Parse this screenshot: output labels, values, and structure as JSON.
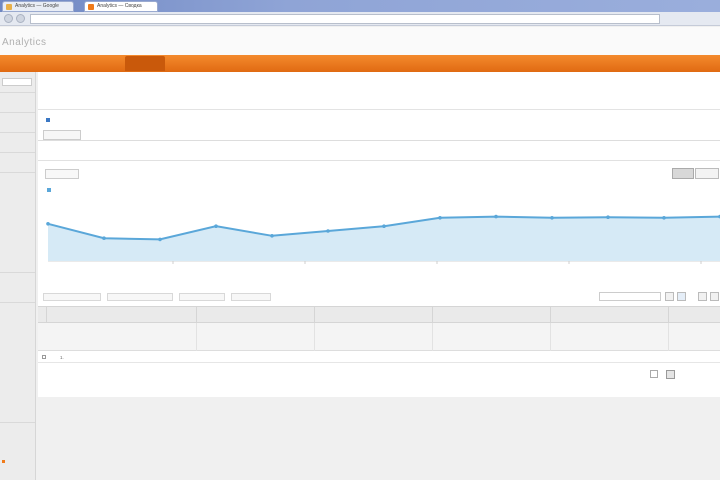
{
  "browser": {
    "tabs": [
      {
        "label": "Analytics — Google"
      },
      {
        "label": "Analytics — Сводка"
      }
    ],
    "url": ""
  },
  "header": {
    "logo": "Analytics",
    "user_email": "",
    "settings_label": "",
    "signout_label": ""
  },
  "nav": {
    "profile": "",
    "tab_home": "",
    "tab_custom": "",
    "right": ""
  },
  "report": {
    "title": "",
    "date_range": "",
    "subtabs": [
      "",
      "",
      "",
      "",
      "",
      ""
    ],
    "segment_label": "",
    "explorer_button": "",
    "metric_links": {
      "prefix": "",
      "link": ""
    },
    "metric_dropdown": "",
    "compare_link": "",
    "period_day": "",
    "period_week": "",
    "legend_label": ""
  },
  "chart_data": {
    "type": "area",
    "series": [
      {
        "values": [
          62,
          38,
          36,
          58,
          42,
          50,
          58,
          72,
          74,
          72,
          73,
          72,
          74
        ]
      }
    ],
    "color": "#5aa7d9",
    "fill": "#d6eaf6",
    "ylim": [
      0,
      100
    ],
    "grid": false,
    "x_tick_count": 6
  },
  "table": {
    "toolbar": [
      "",
      "",
      "",
      "",
      ""
    ],
    "filters": [
      "",
      "",
      "",
      ""
    ],
    "headers": [
      "",
      "",
      "",
      "",
      "",
      "",
      ""
    ],
    "totals": [
      {
        "value": "",
        "sub": ""
      },
      {
        "value": "",
        "sub": ""
      },
      {
        "value": "",
        "sub": ""
      },
      {
        "value": "",
        "sub": ""
      },
      {
        "value": "",
        "sub": ""
      }
    ],
    "rows": [
      {
        "index": "1.",
        "label": "",
        "cells": [
          "",
          "",
          "",
          "",
          ""
        ]
      }
    ]
  },
  "pagination": {
    "label": "",
    "range": ""
  },
  "accent": "#f07b1a",
  "link_color": "#4a7cc0"
}
